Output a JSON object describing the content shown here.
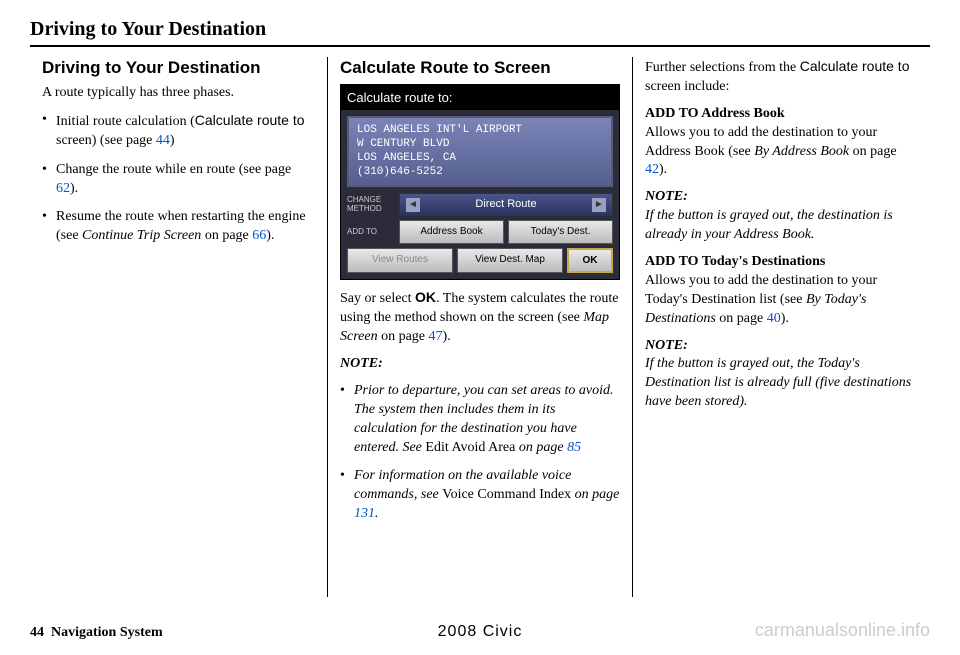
{
  "header": "Driving to Your Destination",
  "col1": {
    "title": "Driving to Your Destination",
    "intro": "A route typically has three phases.",
    "items": [
      {
        "pre": "Initial route calculation (",
        "sans": "Calculate route to",
        "post": " screen) (see page ",
        "link": "44",
        "post2": ")"
      },
      {
        "pre": "Change the route while en route (see page ",
        "link": "62",
        "post2": ")."
      },
      {
        "pre": "Resume the route when restarting the engine (see ",
        "ital": "Continue Trip Screen",
        "post": " on page ",
        "link": "66",
        "post2": ")."
      }
    ]
  },
  "col2": {
    "title": "Calculate Route to Screen",
    "scr": {
      "title": "Calculate route to:",
      "dest": [
        "LOS ANGELES INT'L AIRPORT",
        "W CENTURY BLVD",
        "LOS ANGELES, CA",
        "(310)646-5252"
      ],
      "methodLabel1": "CHANGE",
      "methodLabel2": "METHOD",
      "method": "Direct Route",
      "addtoLabel": "ADD TO",
      "addbook": "Address Book",
      "today": "Today's Dest.",
      "viewroutes": "View Routes",
      "viewdest": "View Dest. Map",
      "ok": "OK"
    },
    "p1a": "Say or select ",
    "p1b": "OK",
    "p1c": ". The system calculates the route using the method shown on the screen (see ",
    "p1d": "Map Screen",
    "p1e": " on page ",
    "p1link": "47",
    "p1f": ").",
    "noteLabel": "NOTE:",
    "notes": [
      {
        "ital1": "Prior to departure, you can set areas to avoid. The system then includes them in its calculation for the destination you have entered. See ",
        "plain": "Edit Avoid Area",
        "ital2": " on page ",
        "link": "85"
      },
      {
        "ital1": "For information on the available voice commands, see ",
        "plain": "Voice Command Index",
        "ital2": " on page ",
        "link": "131",
        "tail": "."
      }
    ]
  },
  "col3": {
    "p1a": "Further selections from the ",
    "p1b": "Calculate route to",
    "p1c": " screen include:",
    "h1": "ADD TO Address Book",
    "p2a": "Allows you to add the destination to your Address Book (see ",
    "p2b": "By Address Book",
    "p2c": " on page ",
    "p2link": "42",
    "p2d": ").",
    "noteLabel1": "NOTE:",
    "note1": "If the button is grayed out, the destination is already in your Address Book.",
    "h2": "ADD TO Today's Destinations",
    "p3a": "Allows you to add the destination to your Today's Destination list (see ",
    "p3b": "By Today's Destinations",
    "p3c": " on page ",
    "p3link": "40",
    "p3d": ").",
    "noteLabel2": "NOTE:",
    "note2": "If the button is grayed out, the Today's Destination list is already full (five destinations have been stored)."
  },
  "footer": {
    "pagenum": "44",
    "section": "Navigation System",
    "center": "2008  Civic",
    "watermark": "carmanualsonline.info"
  }
}
